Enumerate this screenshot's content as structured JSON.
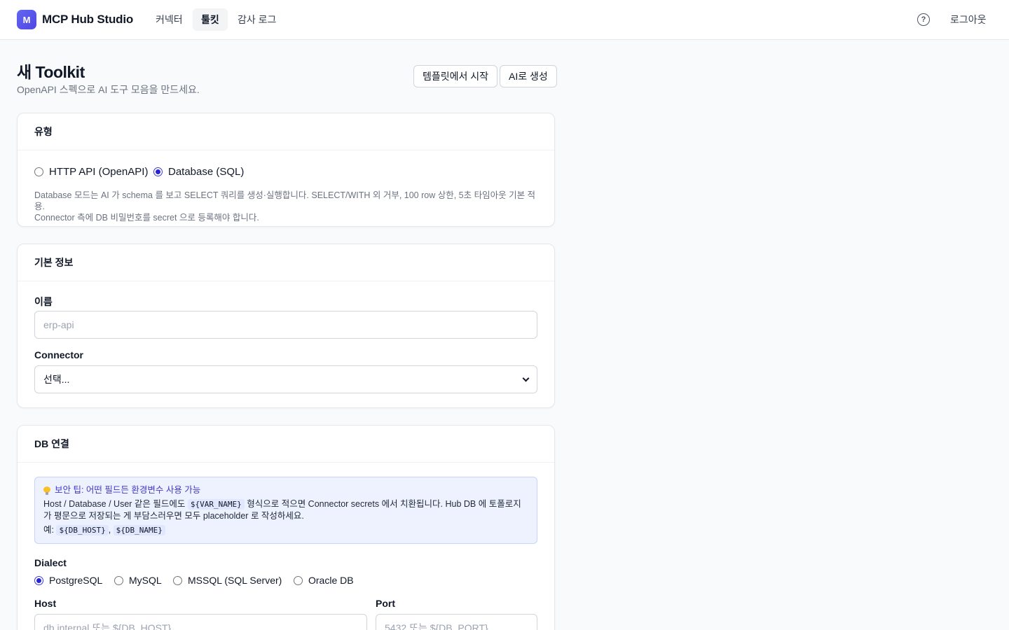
{
  "app": {
    "logo_letter": "M",
    "title": "MCP Hub Studio"
  },
  "nav": {
    "tabs": [
      {
        "label": "커넥터"
      },
      {
        "label": "툴킷",
        "active": true
      },
      {
        "label": "감사 로그"
      }
    ]
  },
  "header": {
    "help_icon": "question-circle-icon",
    "logout_label": "로그아웃"
  },
  "page": {
    "title": "새 Toolkit",
    "subtitle": "OpenAPI 스펙으로 AI 도구 모음을 만드세요.",
    "template_button": "템플릿에서 시작",
    "ai_button": "AI로 생성"
  },
  "type_card": {
    "title": "유형",
    "options": [
      {
        "label": "HTTP API (OpenAPI)",
        "selected": false
      },
      {
        "label": "Database (SQL)",
        "selected": true
      }
    ],
    "help_line1": "Database 모드는 AI 가 schema 를 보고 SELECT 쿼리를 생성·실행합니다. SELECT/WITH 외 거부, 100 row 상한, 5초 타임아웃 기본 적용.",
    "help_line2": "Connector 측에 DB 비밀번호를 secret 으로 등록해야 합니다."
  },
  "basic_card": {
    "title": "기본 정보",
    "name_label": "이름",
    "name_placeholder": "erp-api",
    "connector_label": "Connector",
    "connector_value": "선택..."
  },
  "db_card": {
    "title": "DB 연결",
    "tip_title": "보안 팁: 어떤 필드든 환경변수 사용 가능",
    "tip_text_1": "Host / Database / User 같은 필드에도",
    "tip_code_1": "${VAR_NAME}",
    "tip_text_2": "형식으로 적으면 Connector secrets 에서 치환됩니다. Hub DB 에 토폴로지가 평문으로 저장되는 게 부담스러우면 모두 placeholder 로 작성하세요.",
    "tip_example_label": "예:",
    "tip_code_2": "${DB_HOST}",
    "tip_sep": ",",
    "tip_code_3": "${DB_NAME}",
    "dialect_label": "Dialect",
    "dialects": [
      {
        "label": "PostgreSQL",
        "selected": true
      },
      {
        "label": "MySQL",
        "selected": false
      },
      {
        "label": "MSSQL (SQL Server)",
        "selected": false
      },
      {
        "label": "Oracle DB",
        "selected": false
      }
    ],
    "host_label": "Host",
    "host_placeholder": "db.internal 또는 ${DB_HOST}",
    "port_label": "Port",
    "port_placeholder": "5432 또는 ${DB_PORT}"
  }
}
